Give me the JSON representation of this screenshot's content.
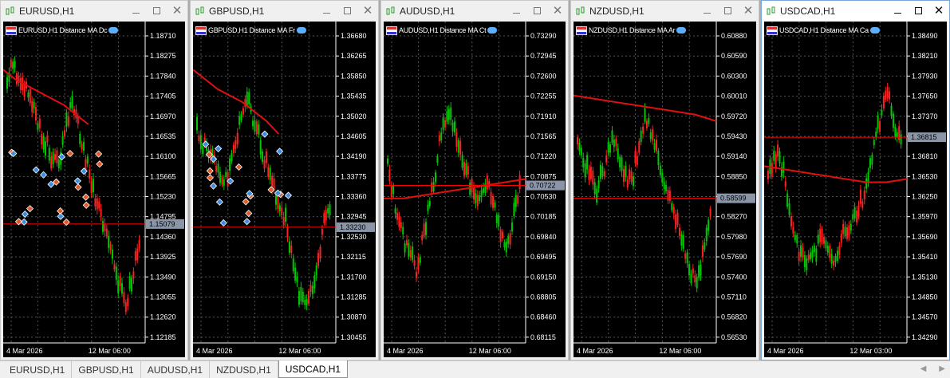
{
  "windows": [
    {
      "title": "EURUSD,H1",
      "indicator_label": "EURUSD,H1 Distance MA Dc",
      "prices": [
        "1.18710",
        "1.18275",
        "1.17840",
        "1.17405",
        "1.16970",
        "1.16535",
        "1.16100",
        "1.15665",
        "1.15230",
        "1.14795",
        "1.14360",
        "1.13925",
        "1.13490",
        "1.13055",
        "1.12620",
        "1.12185"
      ],
      "current_price": "1.15079",
      "dates": [
        "4 Mar 2026",
        "12 Mar 06:00"
      ],
      "series": [
        0.83,
        0.86,
        0.84,
        0.8,
        0.78,
        0.74,
        0.7,
        0.66,
        0.62,
        0.58,
        0.55,
        0.6,
        0.68,
        0.74,
        0.7,
        0.64,
        0.58,
        0.52,
        0.46,
        0.4,
        0.36,
        0.3,
        0.24,
        0.18,
        0.12,
        0.16,
        0.24,
        0.32
      ],
      "ma": [
        0.85,
        0.82,
        0.8,
        0.78,
        0.76,
        0.74,
        0.71,
        0.68
      ],
      "hline": 0.37,
      "markers": true
    },
    {
      "title": "GBPUSD,H1",
      "indicator_label": "GBPUSD,H1 Distance MA Fr",
      "prices": [
        "1.36680",
        "1.36265",
        "1.35850",
        "1.35435",
        "1.35020",
        "1.34605",
        "1.34190",
        "1.33775",
        "1.33360",
        "1.32945",
        "1.32530",
        "1.32115",
        "1.31700",
        "1.31285",
        "1.30870",
        "1.30455"
      ],
      "current_price": "1.33230",
      "dates": [
        "4 Mar 2026",
        "12 Mar 06:00"
      ],
      "series": [
        0.66,
        0.62,
        0.6,
        0.58,
        0.55,
        0.52,
        0.5,
        0.55,
        0.62,
        0.7,
        0.76,
        0.72,
        0.68,
        0.62,
        0.56,
        0.5,
        0.46,
        0.42,
        0.38,
        0.3,
        0.22,
        0.14,
        0.1,
        0.14,
        0.22,
        0.3,
        0.38,
        0.42
      ],
      "ma": [
        0.85,
        0.82,
        0.79,
        0.77,
        0.75,
        0.72,
        0.69,
        0.65
      ],
      "hline": 0.36,
      "markers": true
    },
    {
      "title": "AUDUSD,H1",
      "indicator_label": "AUDUSD,H1 Distance MA Ct",
      "prices": [
        "0.73290",
        "0.72945",
        "0.72600",
        "0.72255",
        "0.71910",
        "0.71565",
        "0.71220",
        "0.70875",
        "0.70530",
        "0.70185",
        "0.69840",
        "0.69495",
        "0.69150",
        "0.68805",
        "0.68460",
        "0.68115"
      ],
      "current_price": "0.70722",
      "dates": [
        "4 Mar 2026",
        "12 Mar 06:00"
      ],
      "series": [
        0.55,
        0.48,
        0.4,
        0.34,
        0.3,
        0.26,
        0.22,
        0.3,
        0.38,
        0.46,
        0.56,
        0.66,
        0.72,
        0.7,
        0.66,
        0.6,
        0.54,
        0.48,
        0.44,
        0.46,
        0.5,
        0.48,
        0.42,
        0.36,
        0.3,
        0.34,
        0.42,
        0.5
      ],
      "ma": [
        0.45,
        0.45,
        0.46,
        0.47,
        0.48,
        0.49,
        0.5,
        0.51
      ],
      "hline": 0.49,
      "markers": false
    },
    {
      "title": "NZDUSD,H1",
      "indicator_label": "NZDUSD,H1 Distance MA Ar",
      "prices": [
        "0.60880",
        "0.60590",
        "0.60300",
        "0.60010",
        "0.59720",
        "0.59430",
        "0.59140",
        "0.58850",
        "0.58560",
        "0.58270",
        "0.57980",
        "0.57690",
        "0.57400",
        "0.57110",
        "0.56820",
        "0.56530"
      ],
      "current_price": "0.58599",
      "dates": [
        "4 Mar 2026",
        "12 Mar 06:00"
      ],
      "series": [
        0.62,
        0.58,
        0.54,
        0.5,
        0.48,
        0.52,
        0.58,
        0.62,
        0.6,
        0.56,
        0.52,
        0.5,
        0.58,
        0.66,
        0.7,
        0.66,
        0.6,
        0.54,
        0.48,
        0.44,
        0.4,
        0.34,
        0.28,
        0.22,
        0.18,
        0.24,
        0.32,
        0.4
      ],
      "ma": [
        0.77,
        0.76,
        0.75,
        0.74,
        0.73,
        0.72,
        0.71,
        0.69
      ],
      "hline": 0.45,
      "markers": false
    },
    {
      "title": "USDCAD,H1",
      "indicator_label": "USDCAD,H1 Distance MA Ca",
      "prices": [
        "1.38490",
        "1.38210",
        "1.37930",
        "1.37650",
        "1.37370",
        "1.37090",
        "1.36810",
        "1.36530",
        "1.36250",
        "1.35970",
        "1.35690",
        "1.35410",
        "1.35130",
        "1.34850",
        "1.34570",
        "1.34290"
      ],
      "current_price": "1.36815",
      "dates": [
        "4 Mar 2026",
        "12 Mar 03:00"
      ],
      "series": [
        0.52,
        0.56,
        0.6,
        0.54,
        0.44,
        0.36,
        0.3,
        0.26,
        0.24,
        0.26,
        0.3,
        0.34,
        0.28,
        0.24,
        0.28,
        0.32,
        0.36,
        0.38,
        0.4,
        0.44,
        0.48,
        0.56,
        0.64,
        0.72,
        0.8,
        0.74,
        0.66,
        0.62
      ],
      "ma": [
        0.55,
        0.54,
        0.53,
        0.52,
        0.51,
        0.5,
        0.5,
        0.51
      ],
      "hline": 0.64,
      "markers": false
    }
  ],
  "active_window": 4,
  "tabs": [
    "EURUSD,H1",
    "GBPUSD,H1",
    "AUDUSD,H1",
    "NZDUSD,H1",
    "USDCAD,H1"
  ],
  "active_tab": 4,
  "colors": {
    "up": "#00c800",
    "down": "#ff2020",
    "ma": "#e01010",
    "hline": "#ff0000",
    "axis": "#ffffff",
    "grid": "#555555"
  }
}
